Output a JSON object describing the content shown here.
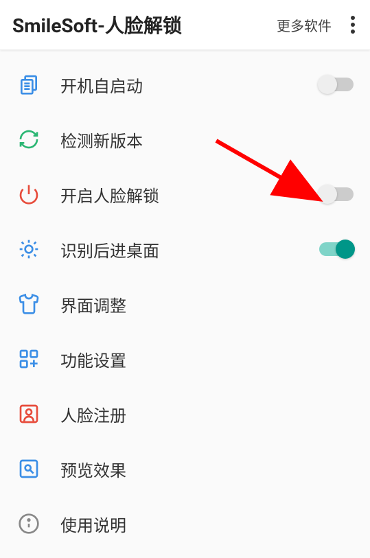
{
  "header": {
    "title": "SmileSoft-人脸解锁",
    "more_apps": "更多软件"
  },
  "settings": [
    {
      "label": "开机自启动",
      "icon": "copy",
      "toggle": "off"
    },
    {
      "label": "检测新版本",
      "icon": "refresh",
      "toggle": null
    },
    {
      "label": "开启人脸解锁",
      "icon": "power",
      "toggle": "off"
    },
    {
      "label": "识别后进桌面",
      "icon": "sun",
      "toggle": "on"
    },
    {
      "label": "界面调整",
      "icon": "shirt",
      "toggle": null
    },
    {
      "label": "功能设置",
      "icon": "grid",
      "toggle": null
    },
    {
      "label": "人脸注册",
      "icon": "person",
      "toggle": null
    },
    {
      "label": "预览效果",
      "icon": "preview",
      "toggle": null
    },
    {
      "label": "使用说明",
      "icon": "info",
      "toggle": null
    }
  ],
  "colors": {
    "teal": "#009688",
    "red": "#ff0000",
    "blue": "#3b8ee6",
    "green": "#2bb673"
  }
}
